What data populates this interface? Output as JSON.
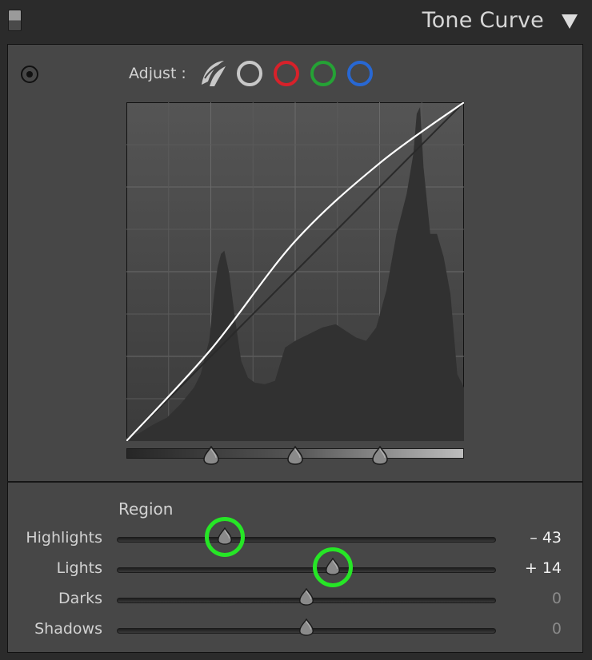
{
  "header": {
    "title": "Tone Curve"
  },
  "adjust": {
    "label": "Adjust :",
    "channels": [
      {
        "name": "parametric",
        "color": "#c8c8c8"
      },
      {
        "name": "rgb",
        "color": "#c8c8c8"
      },
      {
        "name": "red",
        "color": "#d8212a"
      },
      {
        "name": "green",
        "color": "#25a235"
      },
      {
        "name": "blue",
        "color": "#2868d3"
      }
    ]
  },
  "curve": {
    "split_points": [
      0.25,
      0.5,
      0.75
    ],
    "histogram": [
      [
        0,
        0.01
      ],
      [
        0.04,
        0.025
      ],
      [
        0.08,
        0.05
      ],
      [
        0.12,
        0.07
      ],
      [
        0.16,
        0.11
      ],
      [
        0.2,
        0.16
      ],
      [
        0.22,
        0.2
      ],
      [
        0.245,
        0.3
      ],
      [
        0.26,
        0.44
      ],
      [
        0.27,
        0.52
      ],
      [
        0.28,
        0.56
      ],
      [
        0.29,
        0.57
      ],
      [
        0.305,
        0.5
      ],
      [
        0.32,
        0.38
      ],
      [
        0.34,
        0.24
      ],
      [
        0.36,
        0.19
      ],
      [
        0.38,
        0.175
      ],
      [
        0.41,
        0.17
      ],
      [
        0.44,
        0.18
      ],
      [
        0.47,
        0.28
      ],
      [
        0.5,
        0.3
      ],
      [
        0.54,
        0.32
      ],
      [
        0.58,
        0.34
      ],
      [
        0.62,
        0.35
      ],
      [
        0.65,
        0.33
      ],
      [
        0.68,
        0.31
      ],
      [
        0.71,
        0.3
      ],
      [
        0.74,
        0.34
      ],
      [
        0.77,
        0.45
      ],
      [
        0.8,
        0.62
      ],
      [
        0.83,
        0.74
      ],
      [
        0.85,
        0.86
      ],
      [
        0.86,
        0.98
      ],
      [
        0.87,
        1.0
      ],
      [
        0.88,
        0.82
      ],
      [
        0.9,
        0.62
      ],
      [
        0.92,
        0.62
      ],
      [
        0.94,
        0.55
      ],
      [
        0.96,
        0.44
      ],
      [
        0.98,
        0.2
      ],
      [
        1,
        0.16
      ]
    ],
    "curve_points": [
      [
        0,
        0
      ],
      [
        0.25,
        0.27
      ],
      [
        0.5,
        0.59
      ],
      [
        0.75,
        0.82
      ],
      [
        1,
        1
      ]
    ]
  },
  "region": {
    "label": "Region",
    "rows": [
      {
        "label": "Highlights",
        "value": -43,
        "display": "– 43",
        "active": true,
        "circled": true
      },
      {
        "label": "Lights",
        "value": 14,
        "display": "+ 14",
        "active": true,
        "circled": true
      },
      {
        "label": "Darks",
        "value": 0,
        "display": "0",
        "active": false,
        "circled": false
      },
      {
        "label": "Shadows",
        "value": 0,
        "display": "0",
        "active": false,
        "circled": false
      }
    ]
  },
  "colors": {
    "highlight_ring": "#26e626"
  }
}
